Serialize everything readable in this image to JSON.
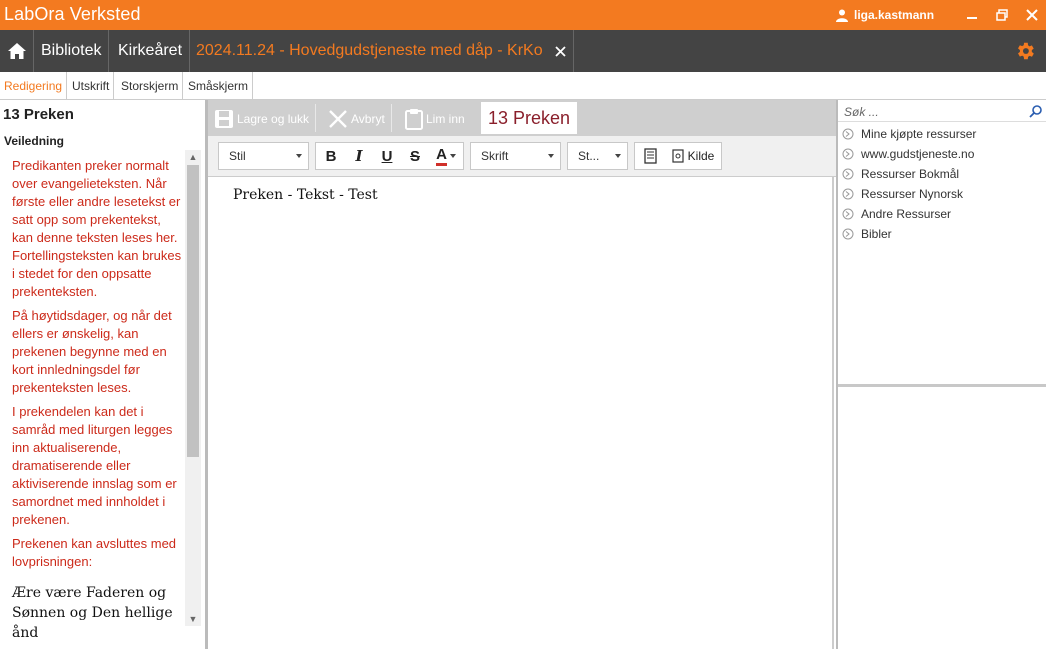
{
  "app": {
    "title": "LabOra Verksted",
    "user": "liga.kastmann"
  },
  "nav": {
    "home": "home",
    "library": "Bibliotek",
    "church_year": "Kirkeåret",
    "document": "2024.11.24 - Hovedgudstjeneste med dåp - KrKo"
  },
  "tabs": [
    "Redigering",
    "Utskrift",
    "Storskjerm",
    "Småskjerm"
  ],
  "left": {
    "title": "13 Preken",
    "subtitle": "Veiledning",
    "guidance": [
      "Predikanten preker normalt over evangelieteksten. Når første eller andre lesetekst er satt opp som prekentekst, kan denne teksten leses her. Fortellingsteksten kan brukes i stedet for den oppsatte prekenteksten.",
      "På høytidsdager, og når det ellers er ønskelig, kan prekenen begynne med en kort innledningsdel før prekenteksten leses.",
      "I prekendelen kan det i samråd med liturgen legges inn aktualiserende, dramatiserende eller aktiviserende innslag som er samordnet med innholdet i prekenen.",
      "Prekenen kan avsluttes med lovprisningen:"
    ],
    "doxology": "Ære være Faderen og Sønnen og Den hellige ånd"
  },
  "toolbar": {
    "save_close": "Lagre og lukk",
    "cancel": "Avbryt",
    "paste": "Lim inn",
    "section": "13 Preken"
  },
  "format": {
    "style": "Stil",
    "font": "Skrift",
    "size": "St...",
    "bold": "B",
    "italic": "I",
    "underline": "U",
    "strike": "S",
    "color": "A",
    "source": "Kilde"
  },
  "editor": {
    "text": "Preken - Tekst - Test"
  },
  "right": {
    "search_placeholder": "Søk ...",
    "items": [
      "Mine kjøpte ressurser",
      "www.gudstjeneste.no",
      "Ressurser Bokmål",
      "Ressurser Nynorsk",
      "Andre Ressurser",
      "Bibler"
    ]
  },
  "colors": {
    "accent": "#f37a20",
    "navbar": "#444444",
    "guidance_text": "#cc2a1a",
    "section": "#8a1f2b"
  }
}
